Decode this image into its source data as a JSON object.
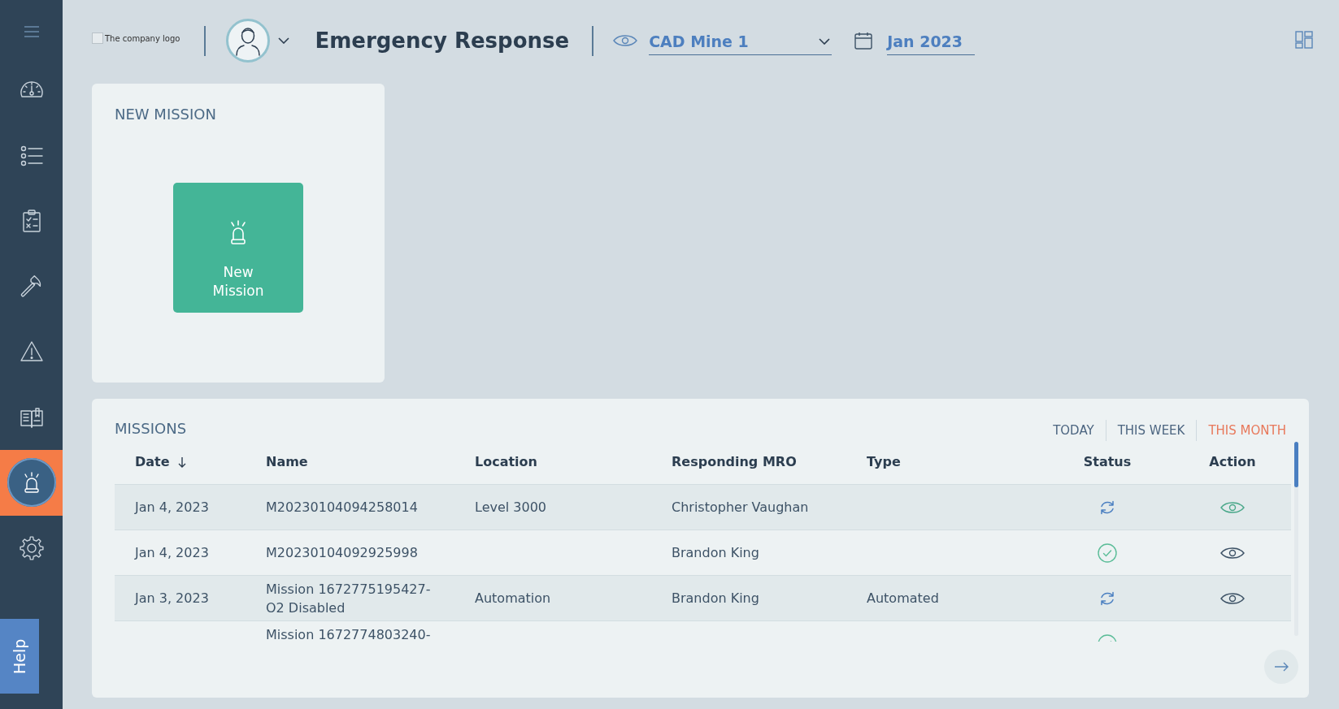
{
  "sidebar": {
    "items": [
      {
        "selected": false
      },
      {
        "selected": false
      },
      {
        "selected": false
      },
      {
        "selected": false
      },
      {
        "selected": false
      },
      {
        "selected": false
      },
      {
        "selected": true
      },
      {
        "selected": false
      }
    ],
    "help_button": "Help"
  },
  "header": {
    "logo_alt_text": "The company logo",
    "title": "Emergency Response",
    "site_select": {
      "value": "CAD Mine 1"
    },
    "period_select": {
      "value": "Jan 2023"
    }
  },
  "new_mission_card": {
    "title": "NEW MISSION",
    "button": "New Mission"
  },
  "missions": {
    "title": "MISSIONS",
    "filters": [
      {
        "label": "TODAY",
        "selected": false
      },
      {
        "label": "THIS WEEK",
        "selected": false
      },
      {
        "label": "THIS MONTH",
        "selected": true
      }
    ],
    "columns": [
      {
        "label": "Date",
        "sorted": true
      },
      {
        "label": "Name",
        "sorted": false
      },
      {
        "label": "Location",
        "sorted": false
      },
      {
        "label": "Responding MRO",
        "sorted": false
      },
      {
        "label": "Type",
        "sorted": false
      },
      {
        "label": "Status",
        "sorted": false
      },
      {
        "label": "Action",
        "sorted": false
      }
    ],
    "rows": [
      {
        "date": "Jan 4, 2023",
        "name": "M20230104094258014",
        "location": "Level 3000",
        "responding_mro": "Christopher Vaughan",
        "completed": false,
        "action_highlighted": true
      },
      {
        "date": "Jan 4, 2023",
        "name": "M20230104092925998",
        "responding_mro": "Brandon King",
        "completed": true,
        "action_highlighted": false
      },
      {
        "date": "Jan 3, 2023",
        "name": "Mission 1672775195427-O2 Disabled",
        "location": "Automation",
        "responding_mro": "Brandon King",
        "type": "Automated",
        "completed": false,
        "action_highlighted": false
      },
      {
        "name": "Mission 1672774803240-",
        "completed": true
      }
    ]
  }
}
